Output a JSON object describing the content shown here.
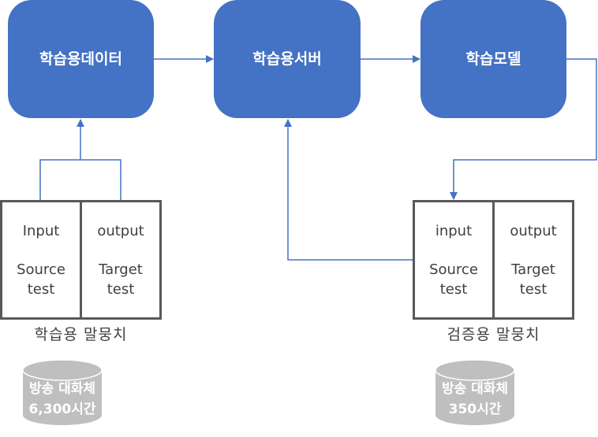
{
  "nodes": [
    {
      "id": "training-data",
      "label": "학습용데이터"
    },
    {
      "id": "training-server",
      "label": "학습용서버"
    },
    {
      "id": "training-model",
      "label": "학습모델"
    }
  ],
  "corpora": {
    "training": {
      "caption": "학습용 말뭉치",
      "columns": [
        {
          "head": "Input",
          "line1": "Source",
          "line2": "test"
        },
        {
          "head": "output",
          "line1": "Target",
          "line2": "test"
        }
      ]
    },
    "validation": {
      "caption": "검증용 말뭉치",
      "columns": [
        {
          "head": "input",
          "line1": "Source",
          "line2": "test"
        },
        {
          "head": "output",
          "line1": "Target",
          "line2": "test"
        }
      ]
    }
  },
  "databases": {
    "training": {
      "line1": "방송 대화체",
      "line2": "6,300시간"
    },
    "validation": {
      "line1": "방송 대화체",
      "line2": "350시간"
    }
  },
  "colors": {
    "node_fill": "#4472c4",
    "connector": "#4472c4",
    "corpus_border": "#595959",
    "database_fill": "#bfbfbf"
  }
}
